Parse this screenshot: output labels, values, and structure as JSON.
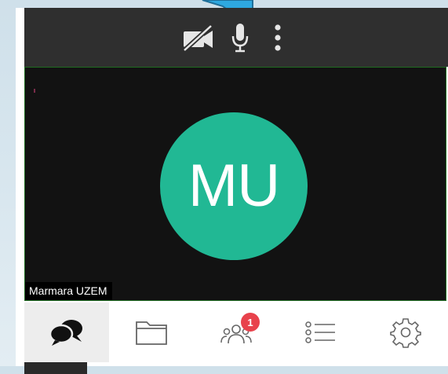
{
  "toolbar": {
    "camera_icon": "camera-off-icon",
    "mic_icon": "microphone-icon",
    "more_icon": "more-vertical-icon"
  },
  "video": {
    "avatar_initials": "MU",
    "participant_name": "Marmara UZEM"
  },
  "tabs": [
    {
      "name": "chat",
      "icon": "chat-bubbles-icon",
      "active": true
    },
    {
      "name": "files",
      "icon": "folder-icon",
      "active": false
    },
    {
      "name": "participants",
      "icon": "participants-icon",
      "badge": "1",
      "active": false
    },
    {
      "name": "list",
      "icon": "list-icon",
      "active": false
    },
    {
      "name": "settings",
      "icon": "gear-icon",
      "active": false
    }
  ],
  "colors": {
    "avatar": "#21b894",
    "toolbar_bg": "#2f2f2f",
    "video_bg": "#121212",
    "badge": "#e8424c",
    "arrow": "#2ea8e0"
  }
}
